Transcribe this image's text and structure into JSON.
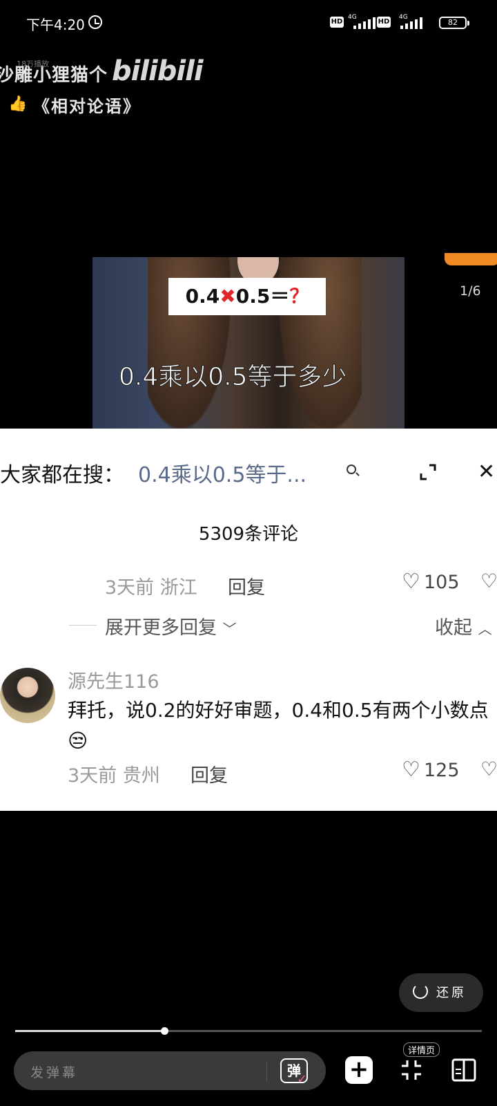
{
  "status_bar": {
    "time": "下午4:20",
    "hd1": "HD",
    "sig1": "4G",
    "hd2": "HD",
    "sig2": "4G",
    "battery": "82"
  },
  "video": {
    "uploader": "沙雕小狸猫个",
    "views": "18万播放",
    "brand": "bilibili",
    "title": "《相对论语》",
    "equation": {
      "left": "0.4",
      "op": "✖",
      "right": "0.5＝",
      "q": "？"
    },
    "subtitle": "0.4乘以0.5等于多少",
    "page_indicator": "1/6"
  },
  "comments": {
    "search_label": "大家都在搜：",
    "search_query": "0.4乘以0.5等于...",
    "count_label": "5309条评论",
    "first": {
      "time": "3天前",
      "location": "浙江",
      "reply": "回复",
      "likes": "105"
    },
    "more_replies": "展开更多回复",
    "collapse": "收起",
    "second": {
      "name": "源先生116",
      "text": "拜托，说0.2的好好审题，0.4和0.5有两个小数点😒",
      "time": "3天前",
      "location": "贵州",
      "reply": "回复",
      "likes": "125"
    }
  },
  "controls": {
    "restore_label": "还原",
    "progress": 0.32,
    "danmaku_placeholder": "发弹幕",
    "danmaku_btn": "弹",
    "detail_label": "详情页"
  },
  "colors": {
    "accent_pink": "#f25d8e",
    "equation_red": "#e0262b",
    "link_blue": "#5a6a8a"
  }
}
